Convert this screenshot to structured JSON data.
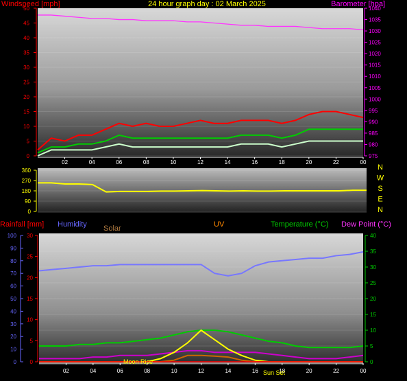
{
  "chart_data": [
    {
      "type": "line",
      "title": "24 hour graph day : 02 March 2025",
      "ylabel": "Windspeed [mph]",
      "y2label": "Barometer [hpa]",
      "x_ticks": [
        "02",
        "04",
        "06",
        "08",
        "10",
        "12",
        "14",
        "16",
        "18",
        "20",
        "22",
        "00"
      ],
      "y_ticks": [
        0,
        5,
        10,
        15,
        20,
        25,
        30,
        35,
        40,
        45,
        50
      ],
      "ylim": [
        0,
        50
      ],
      "y2_ticks": [
        975,
        980,
        985,
        990,
        995,
        1000,
        1005,
        1010,
        1015,
        1020,
        1025,
        1030,
        1035,
        1040
      ],
      "y2lim": [
        975,
        1040
      ],
      "x": [
        0,
        1,
        2,
        3,
        4,
        5,
        6,
        7,
        8,
        9,
        10,
        11,
        12,
        13,
        14,
        15,
        16,
        17,
        18,
        19,
        20,
        21,
        22,
        23,
        24
      ],
      "series": [
        {
          "role": "gust",
          "color": "#ff0000",
          "values": [
            2,
            6,
            5,
            7,
            7,
            9,
            11,
            10,
            11,
            10,
            10,
            11,
            12,
            11,
            11,
            12,
            12,
            12,
            11,
            12,
            14,
            15,
            15,
            14,
            13
          ]
        },
        {
          "role": "average",
          "color": "#00cc00",
          "values": [
            1,
            3,
            3,
            4,
            4,
            5,
            7,
            6,
            6,
            6,
            6,
            6,
            6,
            6,
            6,
            7,
            7,
            7,
            6,
            7,
            9,
            9,
            9,
            9,
            9
          ]
        },
        {
          "role": "speed",
          "color": "#ccffcc",
          "values": [
            0,
            2,
            2,
            2,
            2,
            3,
            4,
            3,
            3,
            3,
            3,
            3,
            3,
            3,
            3,
            4,
            4,
            4,
            3,
            4,
            5,
            5,
            5,
            5,
            5
          ]
        },
        {
          "role": "barometer",
          "axis": "right",
          "color": "#ff33ff",
          "values": [
            1037,
            1037,
            1036.5,
            1036,
            1035.5,
            1035.5,
            1035,
            1035,
            1034.5,
            1034.5,
            1034.5,
            1034,
            1034,
            1033.5,
            1033,
            1032.5,
            1032.5,
            1032,
            1032,
            1032,
            1031.5,
            1031,
            1031,
            1031,
            1030.5
          ]
        }
      ]
    },
    {
      "type": "line",
      "y_ticks": [
        360,
        270,
        180,
        90,
        0
      ],
      "ylim": [
        0,
        360
      ],
      "compass_labels": [
        "N",
        "W",
        "S",
        "E",
        "N"
      ],
      "x": [
        0,
        1,
        2,
        3,
        4,
        5,
        6,
        7,
        8,
        9,
        10,
        11,
        12,
        13,
        14,
        15,
        16,
        17,
        18,
        19,
        20,
        21,
        22,
        23,
        24
      ],
      "series": [
        {
          "role": "wind direction",
          "color": "#ffff00",
          "values": [
            250,
            250,
            240,
            240,
            235,
            170,
            175,
            175,
            175,
            178,
            178,
            180,
            182,
            180,
            178,
            180,
            178,
            178,
            180,
            180,
            180,
            180,
            180,
            185,
            185
          ]
        }
      ]
    },
    {
      "type": "line",
      "labels": {
        "rainfall": "Rainfall [mm]",
        "humidity": "Humidity",
        "solar": "Solar",
        "uv": "UV",
        "temperature": "Temperature (°C)",
        "dewpoint": "Dew Point (°C)"
      },
      "x_ticks": [
        "02",
        "04",
        "06",
        "08",
        "10",
        "12",
        "14",
        "16",
        "18",
        "20",
        "22",
        "00"
      ],
      "humidity_ticks": [
        0,
        10,
        20,
        30,
        40,
        50,
        60,
        70,
        80,
        90,
        100
      ],
      "rain_ticks": [
        0,
        5,
        10,
        15,
        20,
        25,
        30
      ],
      "temp_ticks": [
        0,
        5,
        10,
        15,
        20,
        25,
        30,
        35,
        40
      ],
      "annotations": [
        "Moon Rise",
        "Sun Set"
      ],
      "x": [
        0,
        1,
        2,
        3,
        4,
        5,
        6,
        7,
        8,
        9,
        10,
        11,
        12,
        13,
        14,
        15,
        16,
        17,
        18,
        19,
        20,
        21,
        22,
        23,
        24
      ],
      "series": [
        {
          "role": "humidity",
          "axis": "humidity",
          "color": "#7777ff",
          "values": [
            72,
            73,
            74,
            75,
            76,
            76,
            77,
            77,
            77,
            77,
            77,
            77,
            77,
            70,
            68,
            70,
            76,
            79,
            80,
            81,
            82,
            82,
            84,
            85,
            87
          ]
        },
        {
          "role": "temperature",
          "axis": "temp",
          "color": "#00cc00",
          "values": [
            5,
            5,
            5,
            5.5,
            5.5,
            6,
            6,
            6.5,
            7,
            7.5,
            8.5,
            9.5,
            10,
            10,
            9.5,
            8.5,
            7.5,
            6.5,
            6,
            5,
            4.5,
            4.5,
            4.5,
            4.5,
            5
          ]
        },
        {
          "role": "dew point",
          "axis": "temp",
          "color": "#cc00cc",
          "values": [
            1,
            1,
            1,
            1,
            1.5,
            1.5,
            2,
            2,
            2,
            2.5,
            3,
            3.5,
            3.5,
            3,
            3,
            3,
            3,
            2.5,
            2,
            1.5,
            1,
            1,
            1,
            1.5,
            2
          ]
        },
        {
          "role": "solar",
          "axis": "temp",
          "color": "#ffff00",
          "values": [
            0,
            0,
            0,
            0,
            0,
            0,
            0,
            0,
            0,
            1,
            3,
            6,
            10,
            7,
            4,
            2,
            0.5,
            0,
            0,
            0,
            0,
            0,
            0,
            0,
            0
          ]
        },
        {
          "role": "uv",
          "axis": "temp",
          "color": "#cc6600",
          "values": [
            0,
            0,
            0,
            0,
            0,
            0,
            0,
            0,
            0,
            0,
            0.5,
            2,
            2,
            1.8,
            1.5,
            0.5,
            0,
            0,
            0,
            0,
            0,
            0,
            0,
            0,
            0
          ]
        },
        {
          "role": "rainfall",
          "axis": "rain",
          "color": "#ff0000",
          "values": [
            0,
            0,
            0,
            0,
            0,
            0,
            0,
            0,
            0,
            0,
            0,
            0,
            0,
            0,
            0,
            0,
            0,
            0,
            0,
            0,
            0,
            0,
            0,
            0,
            0
          ]
        }
      ]
    }
  ]
}
